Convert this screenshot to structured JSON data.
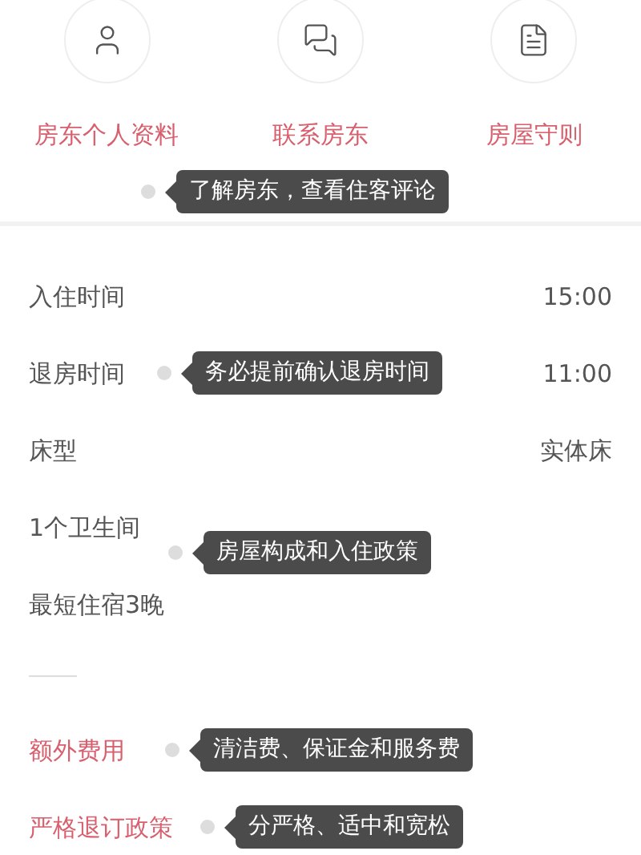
{
  "host_actions": [
    {
      "label": "房东个人资料"
    },
    {
      "label": "联系房东"
    },
    {
      "label": "房屋守则"
    }
  ],
  "host_callout": "了解房东，查看住客评论",
  "details": [
    {
      "label": "入住时间",
      "value": "15:00"
    },
    {
      "label": "退房时间",
      "value": "11:00",
      "callout": "务必提前确认退房时间"
    },
    {
      "label": "床型",
      "value": "实体床"
    },
    {
      "label": "1个卫生间",
      "callout": "房屋构成和入住政策"
    },
    {
      "label": "最短住宿3晚"
    }
  ],
  "policies": [
    {
      "label": "额外费用",
      "callout": "清洁费、保证金和服务费"
    },
    {
      "label": "严格退订政策",
      "callout": "分严格、适中和宽松"
    }
  ]
}
